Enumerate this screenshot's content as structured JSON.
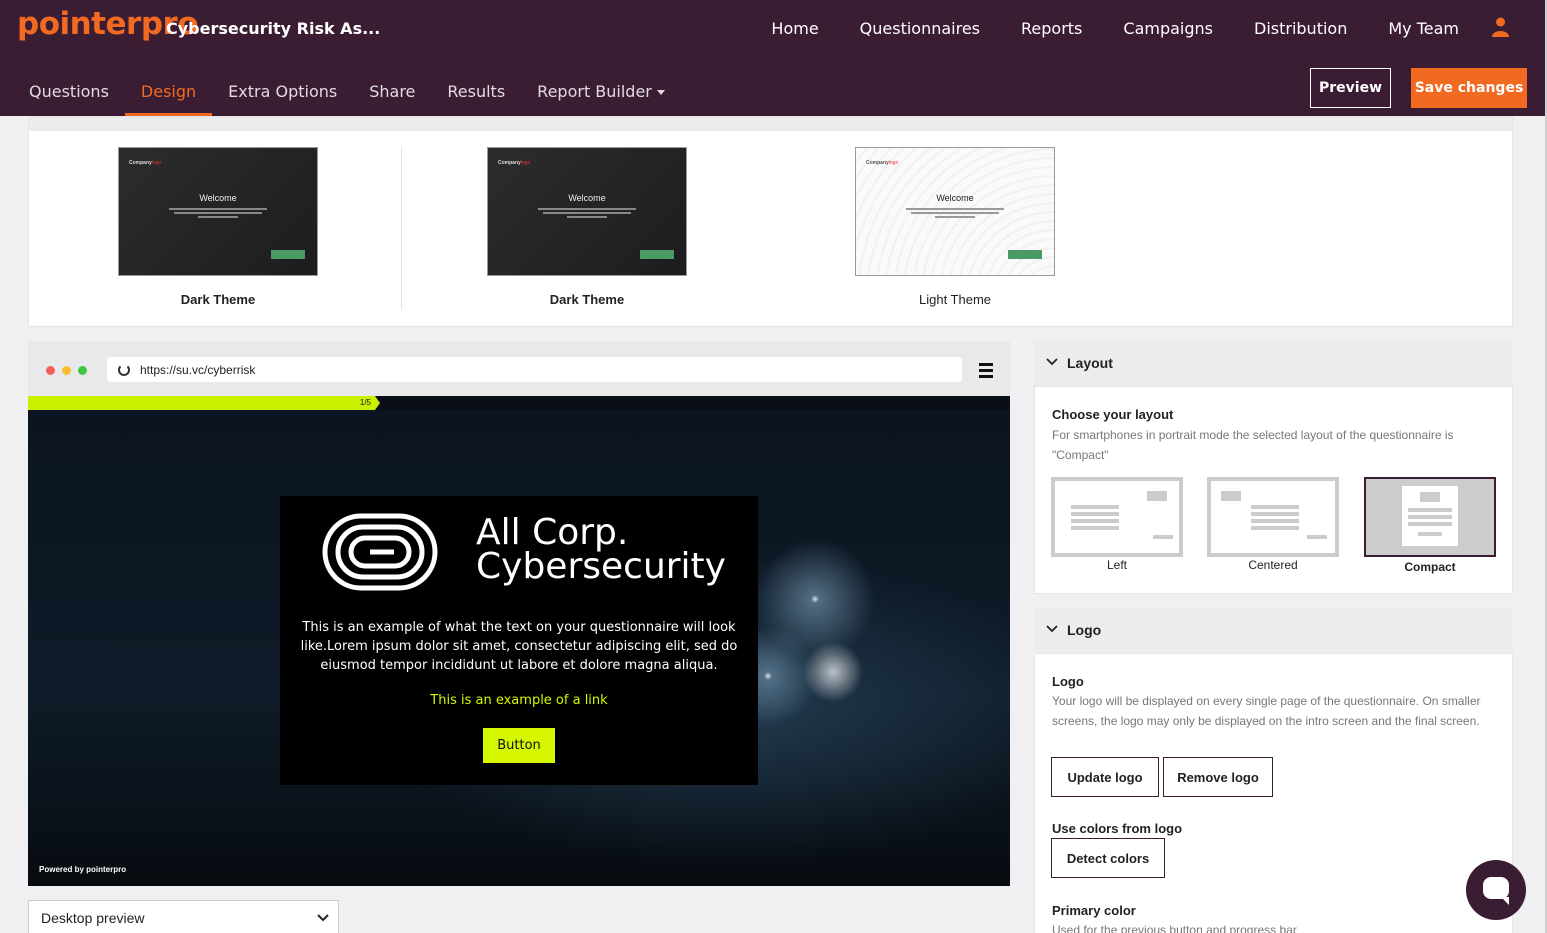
{
  "app": {
    "brand": "pointerpro",
    "doc_title": "Cybersecurity Risk As..."
  },
  "nav": {
    "items": [
      "Home",
      "Questionnaires",
      "Reports",
      "Campaigns",
      "Distribution",
      "My Team"
    ]
  },
  "tabs": {
    "items": [
      "Questions",
      "Design",
      "Extra Options",
      "Share",
      "Results",
      "Report Builder"
    ],
    "active": "Design"
  },
  "toolbar": {
    "preview_label": "Preview",
    "save_label": "Save changes"
  },
  "themes": [
    {
      "label": "Dark Theme",
      "logo": "Company",
      "logo_accent": "logo",
      "welcome": "Welcome"
    },
    {
      "label": "Dark Theme",
      "logo": "Company",
      "logo_accent": "logo",
      "welcome": "Welcome"
    },
    {
      "label": "Light Theme",
      "logo": "Company",
      "logo_accent": "logo",
      "welcome": "Welcome"
    }
  ],
  "preview": {
    "url": "https://su.vc/cyberrisk",
    "progress_text": "1/5",
    "brand_line1": "All Corp.",
    "brand_line2": "Cybersecurity",
    "body_text": "This is an example of what the text on your questionnaire will look like.Lorem ipsum dolor sit amet, consectetur adipiscing elit, sed do eiusmod tempor incididunt ut labore et dolore magna aliqua.",
    "link_text": "This is an example of a link",
    "button_label": "Button",
    "powered_by": "Powered by pointerpro",
    "device_select": "Desktop preview"
  },
  "layout_section": {
    "header": "Layout",
    "title": "Choose your layout",
    "description": "For smartphones in portrait mode the selected layout of the questionnaire is \"Compact\"",
    "options": [
      "Left",
      "Centered",
      "Compact"
    ],
    "selected": "Compact"
  },
  "logo_section": {
    "header": "Logo",
    "title": "Logo",
    "description": "Your logo will be displayed on every single page of the questionnaire. On smaller screens, the logo may only be displayed on the intro screen and the final screen.",
    "update_label": "Update logo",
    "remove_label": "Remove logo",
    "colors_title": "Use colors from logo",
    "detect_label": "Detect colors",
    "primary_title": "Primary color",
    "primary_desc": "Used for the previous button and progress bar"
  },
  "colors": {
    "brand": "#f26a21",
    "nav_bg": "#3b1d33",
    "accent": "#d6f700"
  },
  "icons": [
    "user-icon",
    "reload-icon",
    "menu-icon",
    "chevron-down-icon",
    "chat-icon"
  ]
}
